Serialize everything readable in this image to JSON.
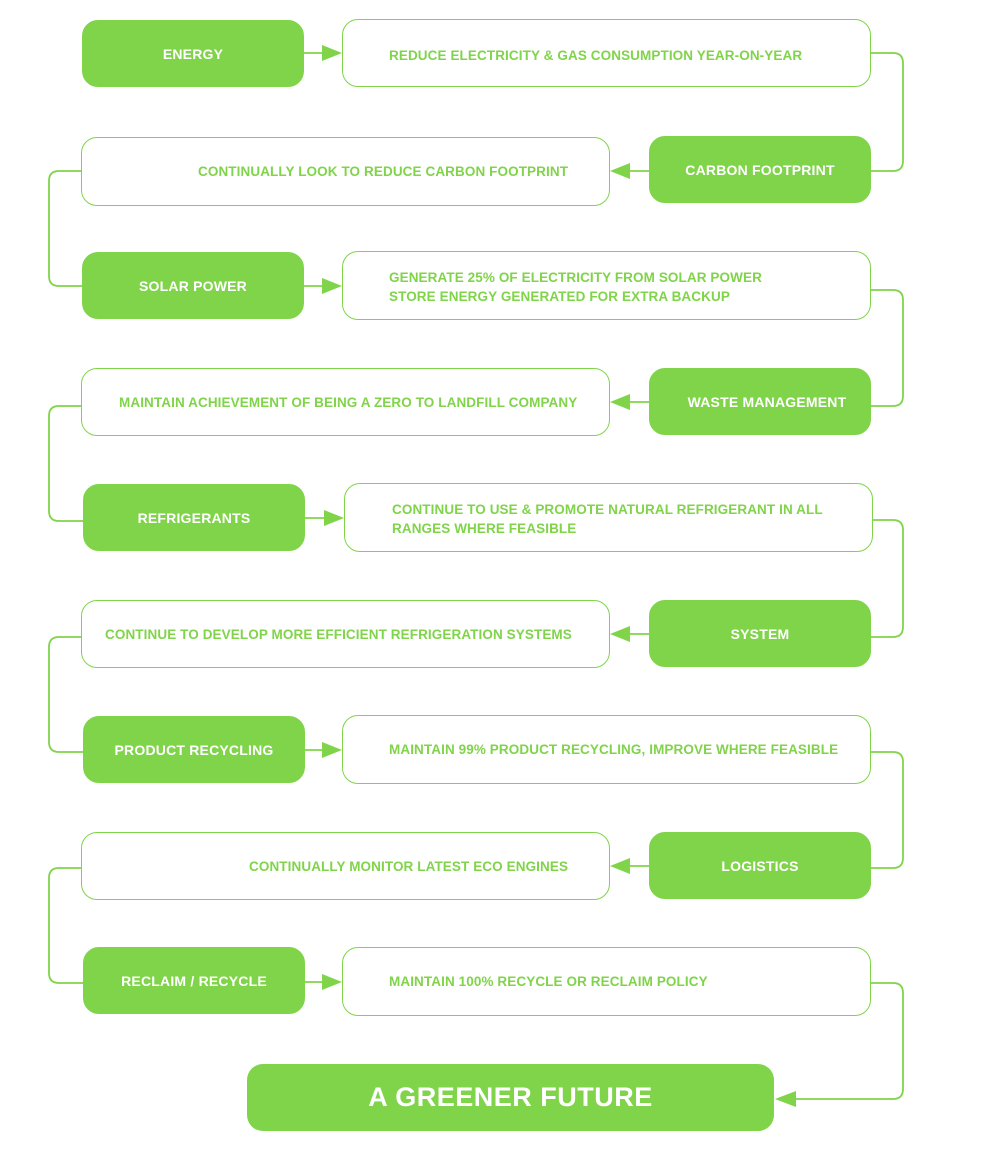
{
  "accent_color": "#80d44a",
  "steps": [
    {
      "category": "ENERGY",
      "description": "REDUCE ELECTRICITY & GAS CONSUMPTION YEAR-ON-YEAR"
    },
    {
      "category": "CARBON FOOTPRINT",
      "description": "CONTINUALLY LOOK TO REDUCE CARBON FOOTPRINT"
    },
    {
      "category": "SOLAR POWER",
      "description": "GENERATE 25% OF ELECTRICITY FROM SOLAR POWER\nSTORE ENERGY GENERATED FOR EXTRA BACKUP"
    },
    {
      "category": "WASTE MANAGEMENT",
      "description": "MAINTAIN ACHIEVEMENT OF BEING A ZERO TO LANDFILL COMPANY"
    },
    {
      "category": "REFRIGERANTS",
      "description": "CONTINUE TO USE & PROMOTE NATURAL REFRIGERANT IN ALL\nRANGES WHERE FEASIBLE"
    },
    {
      "category": "SYSTEM",
      "description": "CONTINUE TO DEVELOP MORE EFFICIENT REFRIGERATION SYSTEMS"
    },
    {
      "category": "PRODUCT RECYCLING",
      "description": "MAINTAIN 99% PRODUCT RECYCLING, IMPROVE WHERE FEASIBLE"
    },
    {
      "category": "LOGISTICS",
      "description": "CONTINUALLY MONITOR LATEST ECO ENGINES"
    },
    {
      "category": "RECLAIM / RECYCLE",
      "description": "MAINTAIN 100% RECYCLE OR RECLAIM POLICY"
    }
  ],
  "final": {
    "label": "A GREENER FUTURE"
  }
}
